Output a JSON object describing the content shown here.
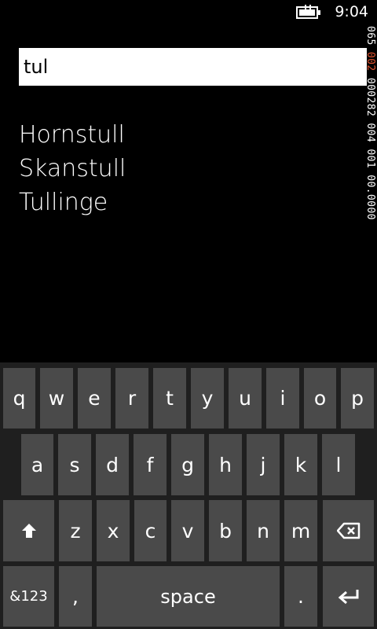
{
  "status": {
    "time": "9:04",
    "battery_icon": "battery-charging-icon"
  },
  "search": {
    "value": "tul"
  },
  "results": [
    "Hornstull",
    "Skanstull",
    "Tullinge"
  ],
  "debug_counter": {
    "part1": "065 ",
    "part2": "002",
    "part3": " 000282 004 001 00.0000"
  },
  "keyboard": {
    "row1": [
      "q",
      "w",
      "e",
      "r",
      "t",
      "y",
      "u",
      "i",
      "o",
      "p"
    ],
    "row2": [
      "a",
      "s",
      "d",
      "f",
      "g",
      "h",
      "j",
      "k",
      "l"
    ],
    "row3": [
      "z",
      "x",
      "c",
      "v",
      "b",
      "n",
      "m"
    ],
    "shift_icon": "shift-arrow-icon",
    "backspace_icon": "backspace-icon",
    "symbols_label": "&123",
    "comma_label": ",",
    "space_label": "space",
    "period_label": ".",
    "enter_icon": "enter-icon"
  }
}
